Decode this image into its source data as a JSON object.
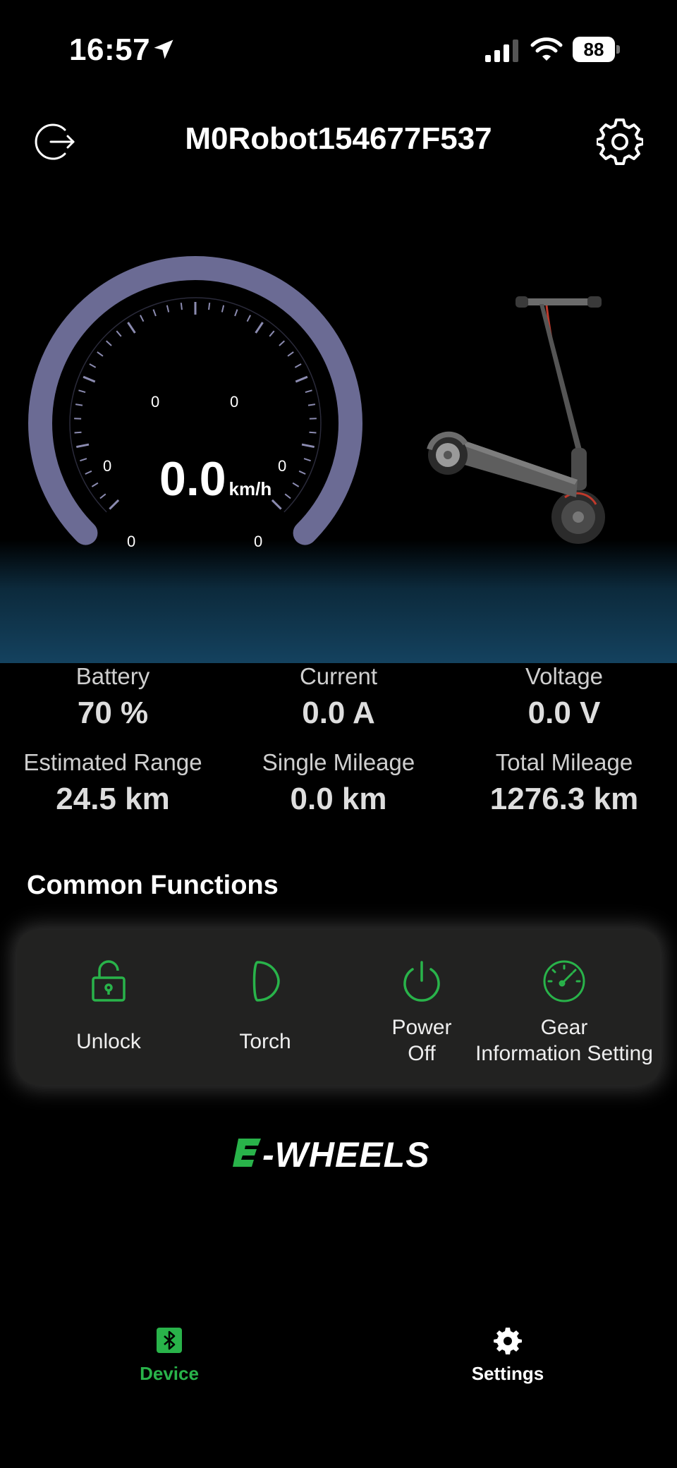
{
  "status_bar": {
    "time": "16:57",
    "battery": "88",
    "icons": [
      "location-arrow-icon",
      "cellular-signal-icon",
      "wifi-icon",
      "battery-icon"
    ]
  },
  "header": {
    "title": "M0Robot154677F537",
    "left_icon": "logout-icon",
    "right_icon": "gear-icon"
  },
  "speedometer": {
    "value": "0.0",
    "unit": "km/h",
    "tick_labels": [
      "0",
      "0",
      "0",
      "0",
      "0",
      "0"
    ],
    "arc_color": "#6b6b94"
  },
  "stats": [
    {
      "label": "Battery",
      "value": "70 %"
    },
    {
      "label": "Current",
      "value": "0.0 A"
    },
    {
      "label": "Voltage",
      "value": "0.0 V"
    },
    {
      "label": "Estimated Range",
      "value": "24.5 km"
    },
    {
      "label": "Single Mileage",
      "value": "0.0 km"
    },
    {
      "label": "Total Mileage",
      "value": "1276.3 km"
    }
  ],
  "common_functions": {
    "title": "Common Functions",
    "items": [
      {
        "icon": "unlock-icon",
        "line1": "Unlock",
        "line2": ""
      },
      {
        "icon": "torch-icon",
        "line1": "Torch",
        "line2": ""
      },
      {
        "icon": "power-icon",
        "line1": "Power",
        "line2": "Off"
      },
      {
        "icon": "gauge-icon",
        "line1": "Gear",
        "line2": "Information Setting"
      }
    ],
    "accent": "#29b34a"
  },
  "brand": {
    "text": "-WHEELS",
    "mark": "E"
  },
  "bottom_nav": {
    "items": [
      {
        "icon": "bluetooth-icon",
        "label": "Device",
        "active": true
      },
      {
        "icon": "gear-icon",
        "label": "Settings",
        "active": false
      }
    ],
    "active_color": "#29b34a"
  }
}
